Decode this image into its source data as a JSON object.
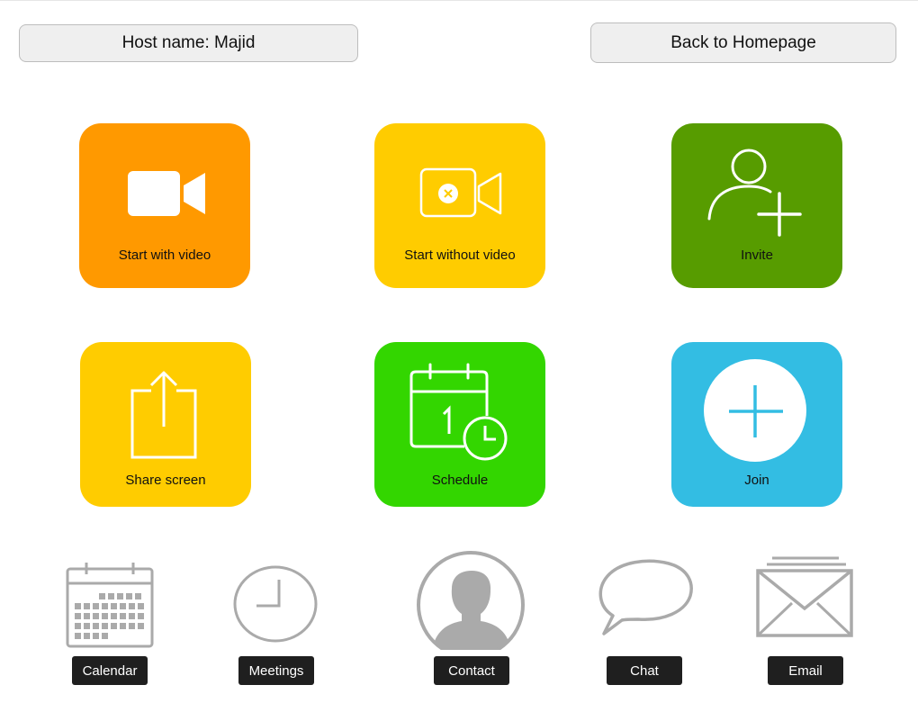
{
  "header": {
    "host_label": "Host name: Majid",
    "back_label": "Back to Homepage"
  },
  "tiles": [
    {
      "label": "Start with video",
      "color": "#ff9900",
      "icon": "video-camera-icon"
    },
    {
      "label": "Start without video",
      "color": "#ffcc00",
      "icon": "video-off-icon"
    },
    {
      "label": "Invite",
      "color": "#579c00",
      "icon": "add-user-icon"
    },
    {
      "label": "Share screen",
      "color": "#ffcc00",
      "icon": "share-icon"
    },
    {
      "label": "Schedule",
      "color": "#33d600",
      "icon": "calendar-clock-icon"
    },
    {
      "label": "Join",
      "color": "#33bde3",
      "icon": "plus-circle-icon"
    }
  ],
  "dock": [
    {
      "label": "Calendar",
      "icon": "calendar-icon"
    },
    {
      "label": "Meetings",
      "icon": "clock-icon"
    },
    {
      "label": "Contact",
      "icon": "contact-icon"
    },
    {
      "label": "Chat",
      "icon": "chat-bubble-icon"
    },
    {
      "label": "Email",
      "icon": "envelope-icon"
    }
  ]
}
